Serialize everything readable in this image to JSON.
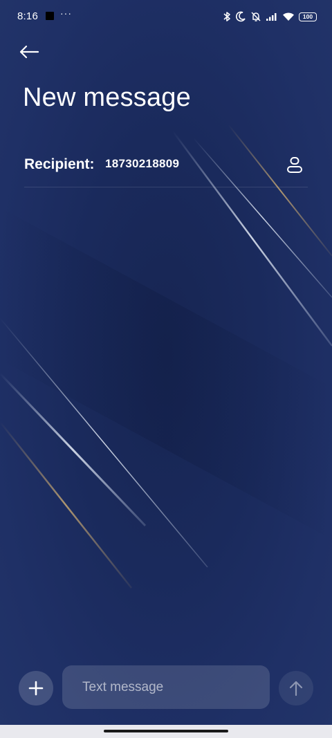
{
  "status_bar": {
    "time": "8:16",
    "extra": "···",
    "battery": "100",
    "icons": [
      "bluetooth-icon",
      "moon-icon",
      "bell-off-icon",
      "signal-icon",
      "wifi-icon",
      "battery-icon"
    ]
  },
  "header": {
    "back_icon": "arrow-left-icon",
    "title": "New message"
  },
  "recipient": {
    "label": "Recipient:",
    "value": "18730218809",
    "contact_icon": "person-icon"
  },
  "composer": {
    "add_icon": "plus-icon",
    "placeholder": "Text message",
    "value": "",
    "send_icon": "arrow-up-icon"
  },
  "colors": {
    "background": "#1f2f63",
    "accent_gold": "#b89a66",
    "accent_silver": "#c9d3e6"
  }
}
